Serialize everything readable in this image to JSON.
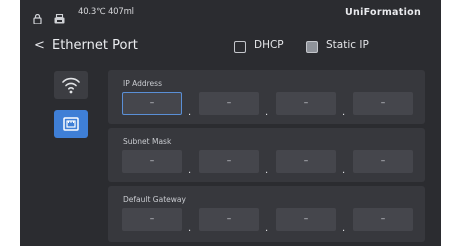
{
  "status": {
    "reading": "40.3℃ 407ml",
    "brand": "UniFormation",
    "icons": [
      "lock-icon",
      "printer-icon"
    ]
  },
  "header": {
    "back_glyph": "<",
    "title": "Ethernet Port",
    "dhcp_label": "DHCP",
    "dhcp_checked": false,
    "static_label": "Static IP",
    "static_checked": true
  },
  "sidebar": {
    "items": [
      {
        "name": "wifi",
        "active": false
      },
      {
        "name": "ethernet",
        "active": true
      }
    ]
  },
  "groups": [
    {
      "label": "IP Address",
      "fields": [
        "–",
        "–",
        "–",
        "–"
      ]
    },
    {
      "label": "Subnet Mask",
      "fields": [
        "–",
        "–",
        "–",
        "–"
      ]
    },
    {
      "label": "Default Gateway",
      "fields": [
        "–",
        "–",
        "–",
        "–"
      ]
    }
  ],
  "separator": ".",
  "colors": {
    "background": "#2b2c30",
    "panel": "#37383d",
    "field": "#45464c",
    "accent": "#3f7fd6"
  }
}
